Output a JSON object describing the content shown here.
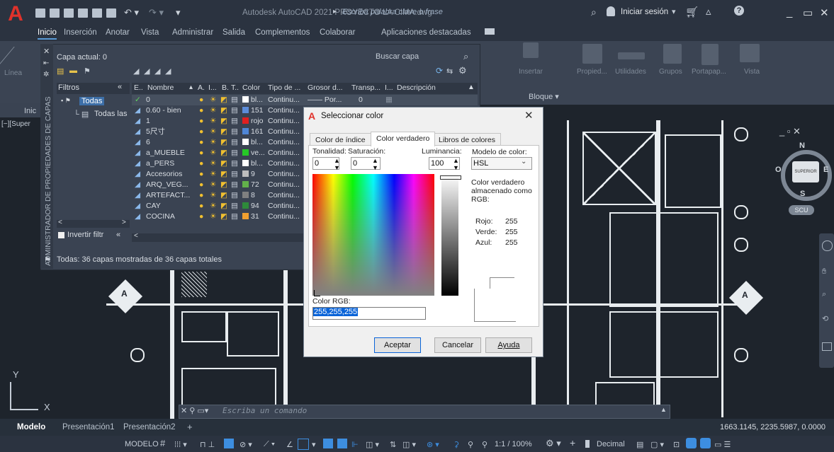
{
  "titlebar": {
    "app_title": "Autodesk AutoCAD 2021   PROYECTO LA CIMA.dwg",
    "search_placeholder": "Escriba palabra clave o frase",
    "login": "Iniciar sesión"
  },
  "ribbon_tabs": [
    "Inicio",
    "Inserción",
    "Anotar",
    "Vista",
    "Administrar",
    "Salida",
    "Complementos",
    "Colaborar",
    "Aplicaciones destacadas"
  ],
  "ribbon_groups": [
    "Insertar",
    "Propied...",
    "Utilidades",
    "Grupos",
    "Portapap...",
    "Vista"
  ],
  "ribbon_misc": {
    "line_label": "Línea",
    "block_label": "Bloque ▾"
  },
  "drawing_tab": {
    "label": "Inic",
    "viewport_label": "[−][Super"
  },
  "layer_manager": {
    "panel_title": "ADMINISTRADOR DE PROPIEDADES DE CAPAS",
    "current_layer": "Capa actual: 0",
    "search_placeholder": "Buscar capa",
    "filters_label": "Filtros",
    "filter_all": "Todas",
    "filter_used": "Todas las capas",
    "invert_filter": "Invertir filtr",
    "columns": [
      "E..",
      "Nombre",
      "A.",
      "I...",
      "B.",
      "T..",
      "Color",
      "Tipo de ...",
      "Grosor d...",
      "Transp...",
      "I...",
      "Descripción"
    ],
    "layers": [
      {
        "name": "0",
        "color": "bl...",
        "color_hex": "#ffffff",
        "linetype": "Continu...",
        "lineweight": "—— Por...",
        "transp": "0"
      },
      {
        "name": "0.60 - bien",
        "color": "151",
        "color_hex": "#5c8cd9",
        "linetype": "Continu..."
      },
      {
        "name": "1",
        "color": "rojo",
        "color_hex": "#e02020",
        "linetype": "Continu..."
      },
      {
        "name": "5尺寸",
        "color": "161",
        "color_hex": "#4f86d6",
        "linetype": "Continu..."
      },
      {
        "name": "6",
        "color": "bl...",
        "color_hex": "#ffffff",
        "linetype": "Continu..."
      },
      {
        "name": "a_MUEBLE",
        "color": "ve...",
        "color_hex": "#26c826",
        "linetype": "Continu..."
      },
      {
        "name": "a_PERS",
        "color": "bl...",
        "color_hex": "#ffffff",
        "linetype": "Continu..."
      },
      {
        "name": "Accesorios",
        "color": "9",
        "color_hex": "#bdbdbd",
        "linetype": "Continu..."
      },
      {
        "name": "ARQ_VEG...",
        "color": "72",
        "color_hex": "#62b04a",
        "linetype": "Continu..."
      },
      {
        "name": "ARTEFACT...",
        "color": "8",
        "color_hex": "#808080",
        "linetype": "Continu..."
      },
      {
        "name": "CAY",
        "color": "94",
        "color_hex": "#2e8a3a",
        "linetype": "Continu..."
      },
      {
        "name": "COCINA",
        "color": "31",
        "color_hex": "#f0a030",
        "linetype": "Continu..."
      }
    ],
    "footer": "Todas: 36 capas mostradas de 36 capas totales"
  },
  "dialog": {
    "title": "Seleccionar color",
    "tabs": [
      "Color de índice",
      "Color verdadero",
      "Libros de colores"
    ],
    "hue_label": "Tonalidad:",
    "sat_label": "Saturación:",
    "lum_label": "Luminancia:",
    "model_label": "Modelo de color:",
    "hue": "0",
    "sat": "0",
    "lum": "100",
    "model": "HSL",
    "stored_note": "Color verdadero almacenado como RGB:",
    "red_label": "Rojo:",
    "red": "255",
    "green_label": "Verde:",
    "green": "255",
    "blue_label": "Azul:",
    "blue": "255",
    "rgb_label": "Color RGB:",
    "rgb_value": "255,255,255",
    "ok": "Aceptar",
    "cancel": "Cancelar",
    "help": "Ayuda"
  },
  "command_line": {
    "placeholder": "Escriba un comando"
  },
  "viewcube": {
    "n": "N",
    "s": "S",
    "e": "E",
    "o": "O",
    "top": "SUPERIOR",
    "ucs": "SCU"
  },
  "axis": {
    "y": "Y",
    "x": "X"
  },
  "layout_tabs": [
    "Modelo",
    "Presentación1",
    "Presentación2",
    "+"
  ],
  "coords": "1663.1145, 2235.5987, 0.0000",
  "status": {
    "model": "MODELO",
    "scale": "1:1 / 100%",
    "units": "Decimal"
  }
}
